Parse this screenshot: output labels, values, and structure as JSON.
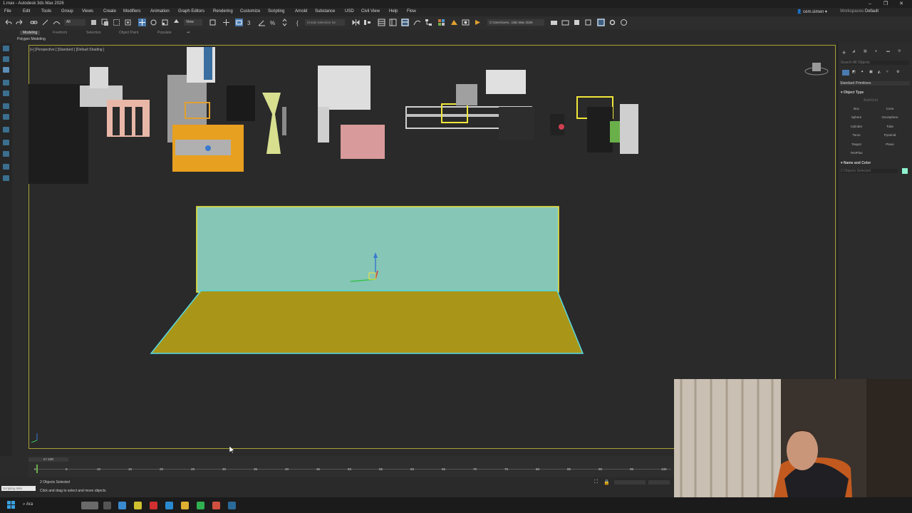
{
  "title_bar": {
    "title": "1.max - Autodesk 3ds Max 2026"
  },
  "menu": {
    "items": [
      "File",
      "Edit",
      "Tools",
      "Group",
      "Views",
      "Create",
      "Modifiers",
      "Animation",
      "Graph Editors",
      "Rendering",
      "Customize",
      "Scripting",
      "Arnold",
      "Substance",
      "USD",
      "Civil View",
      "Help",
      "Flow"
    ],
    "user": "cem.simen",
    "workspaces_label": "Workspaces:",
    "workspace_value": "Default"
  },
  "toolbar": {
    "selection_filter": "All",
    "view_dropdown": "View",
    "create_selection_set": "Create Selection Se",
    "path_field": "C:\\Users\\cem...\\3ds Max 2026"
  },
  "ribbon": {
    "tabs": [
      "Modeling",
      "Freeform",
      "Selection",
      "Object Paint",
      "Populate"
    ],
    "subtab": "Polygon Modeling"
  },
  "viewport": {
    "label": "[+] [Perspective ] [Standard ] [Default Shading ]"
  },
  "command_panel": {
    "search_placeholder": "Search All Objects",
    "category": "Standard Primitives",
    "object_type_header": "Object Type",
    "autogrid": "AutoGrid",
    "primitives": [
      "Box",
      "Cone",
      "Sphere",
      "GeoSphere",
      "Cylinder",
      "Tube",
      "Torus",
      "Pyramid",
      "Teapot",
      "Plane",
      "TextPlus"
    ],
    "name_and_color_header": "Name and Color",
    "name_field": "2 Objects Selected",
    "object_color": "#8ff3cf"
  },
  "timeline": {
    "frame_counter": "0 / 100",
    "ticks": [
      "0",
      "5",
      "10",
      "15",
      "20",
      "25",
      "30",
      "35",
      "40",
      "45",
      "50",
      "55",
      "60",
      "65",
      "70",
      "75",
      "80",
      "85",
      "90",
      "95",
      "100"
    ]
  },
  "status": {
    "maxscript_placeholder": "Scripting Mini",
    "selection_text": "2 Objects Selected",
    "prompt_text": "Click and drag to select and move objects"
  },
  "taskbar": {
    "search_placeholder": "Ara"
  },
  "colors": {
    "accent_selection": "#54d9e6",
    "wall_fill": "#85c6b6",
    "floor_fill": "#a99618",
    "viewport_border": "#a7a234",
    "highlight_yellow": "#f0e63a"
  }
}
